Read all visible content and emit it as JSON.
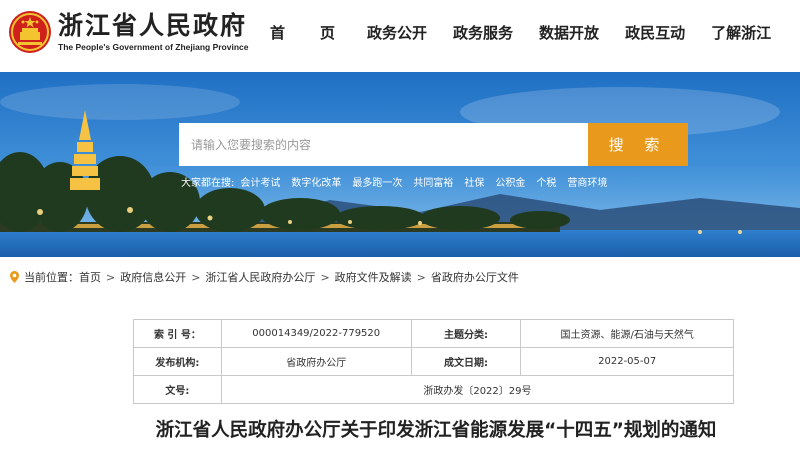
{
  "header": {
    "logo_cn": "浙江省人民政府",
    "logo_en": "The People's Government of Zhejiang Province",
    "nav": [
      "首　页",
      "政务公开",
      "政务服务",
      "数据开放",
      "政民互动",
      "了解浙江"
    ]
  },
  "search": {
    "placeholder": "请输入您要搜索的内容",
    "button": "搜 索",
    "hot_label": "大家都在搜:",
    "hot_items": [
      "会计考试",
      "数字化改革",
      "最多跑一次",
      "共同富裕",
      "社保",
      "公积金",
      "个税",
      "营商环境"
    ]
  },
  "breadcrumb": {
    "label": "当前位置：",
    "items": [
      "首页",
      "政府信息公开",
      "浙江省人民政府办公厅",
      "政府文件及解读",
      "省政府办公厅文件"
    ],
    "separator": ">"
  },
  "info": {
    "index_label": "索 引 号：",
    "index_value": "000014349/2022-779520",
    "category_label": "主题分类:",
    "category_value": "国土资源、能源/石油与天然气",
    "publisher_label": "发布机构:",
    "publisher_value": "省政府办公厅",
    "date_label": "成文日期:",
    "date_value": "2022-05-07",
    "docno_label": "文号:",
    "docno_value": "浙政办发〔2022〕29号"
  },
  "title": "浙江省人民政府办公厅关于印发浙江省能源发展“十四五”规划的通知",
  "colors": {
    "accent": "#e99a1c",
    "emblem_red": "#d0201b",
    "emblem_gold": "#f4c430"
  }
}
